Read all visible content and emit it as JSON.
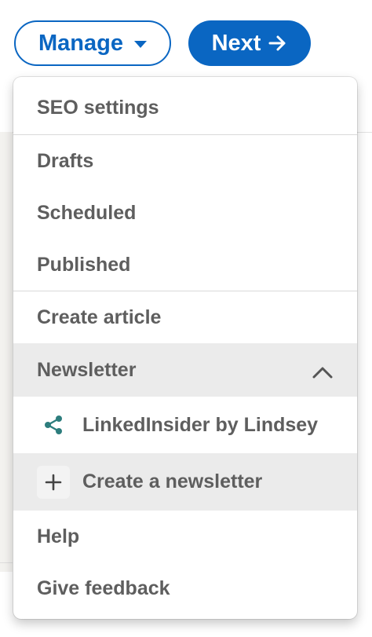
{
  "toolbar": {
    "manage_label": "Manage",
    "next_label": "Next"
  },
  "menu": {
    "seo": "SEO settings",
    "drafts": "Drafts",
    "scheduled": "Scheduled",
    "published": "Published",
    "create_article": "Create article",
    "newsletter": "Newsletter",
    "newsletter_item": "LinkedInsider by Lindsey",
    "create_newsletter": "Create a newsletter",
    "help": "Help",
    "feedback": "Give feedback"
  },
  "icons": {
    "manage_caret": "caret-down-icon",
    "next_arrow": "arrow-right-icon",
    "newsletter_chevron": "chevron-up-icon",
    "share": "share-icon",
    "plus": "plus-icon"
  },
  "colors": {
    "brand_blue": "#0a66c2",
    "share_teal": "#2d7d7d",
    "highlight": "#ebebeb",
    "text": "#5e5e5e"
  }
}
